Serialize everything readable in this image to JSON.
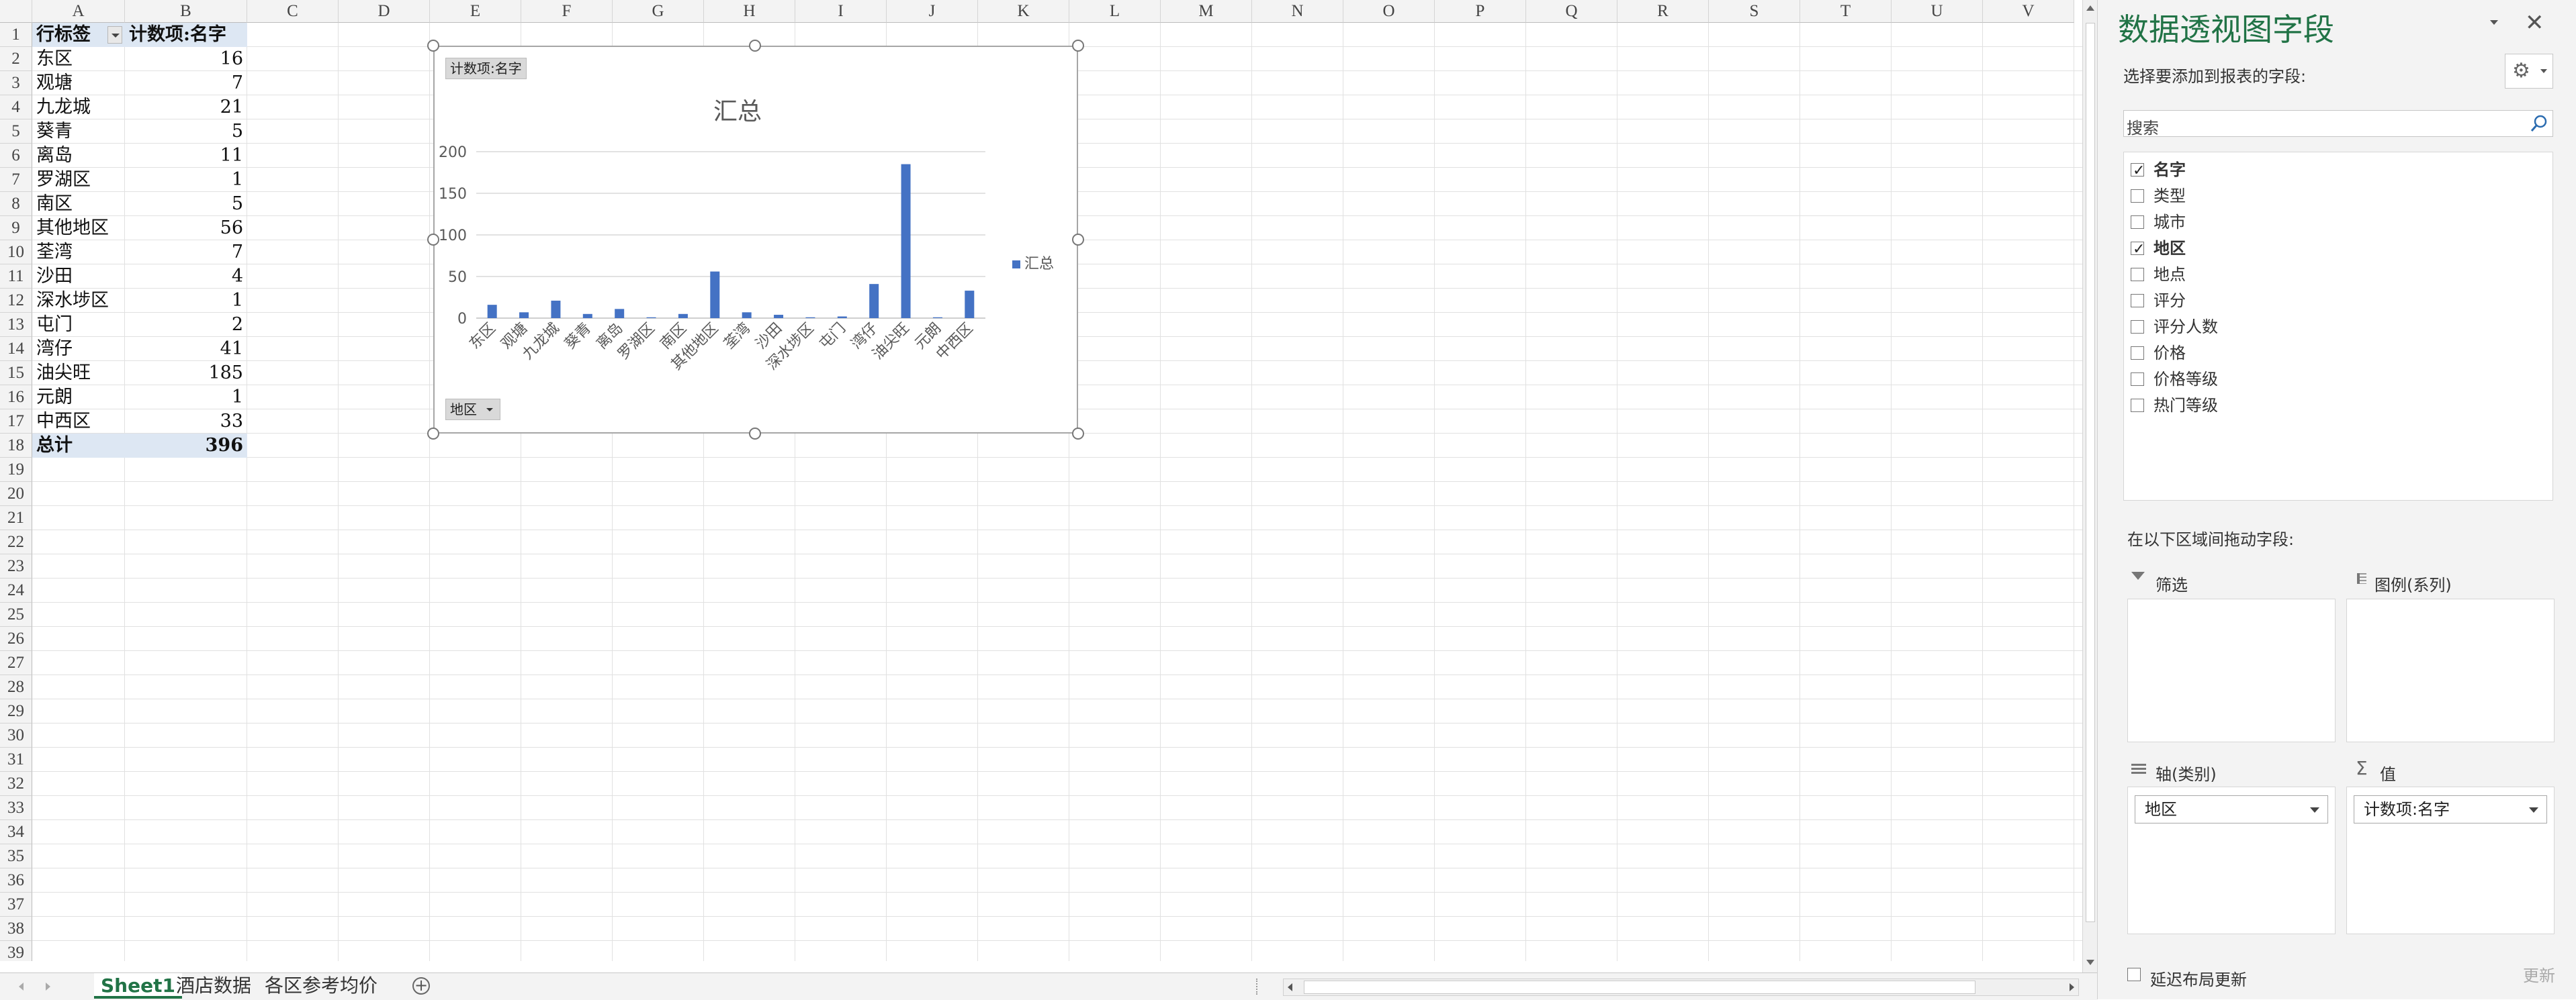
{
  "sheet": {
    "columns": [
      "A",
      "B",
      "C",
      "D",
      "E",
      "F",
      "G",
      "H",
      "I",
      "J",
      "K",
      "L",
      "M",
      "N",
      "O",
      "P",
      "Q",
      "R",
      "S",
      "T",
      "U",
      "V"
    ],
    "rows": [
      "1",
      "2",
      "3",
      "4",
      "5",
      "6",
      "7",
      "8",
      "9",
      "10",
      "11",
      "12",
      "13",
      "14",
      "15",
      "16",
      "17",
      "18",
      "19",
      "20",
      "21",
      "22",
      "23",
      "24",
      "25",
      "26",
      "27",
      "28",
      "29",
      "30",
      "31",
      "32",
      "33",
      "34",
      "35",
      "36",
      "37",
      "38",
      "39"
    ],
    "pivot_header": {
      "row_label": "行标签",
      "value_label": "计数项:名字"
    },
    "pivot_rows": [
      {
        "label": "东区",
        "value": "16"
      },
      {
        "label": "观塘",
        "value": "7"
      },
      {
        "label": "九龙城",
        "value": "21"
      },
      {
        "label": "葵青",
        "value": "5"
      },
      {
        "label": "离岛",
        "value": "11"
      },
      {
        "label": "罗湖区",
        "value": "1"
      },
      {
        "label": "南区",
        "value": "5"
      },
      {
        "label": "其他地区",
        "value": "56"
      },
      {
        "label": "荃湾",
        "value": "7"
      },
      {
        "label": "沙田",
        "value": "4"
      },
      {
        "label": "深水埗区",
        "value": "1"
      },
      {
        "label": "屯门",
        "value": "2"
      },
      {
        "label": "湾仔",
        "value": "41"
      },
      {
        "label": "油尖旺",
        "value": "185"
      },
      {
        "label": "元朗",
        "value": "1"
      },
      {
        "label": "中西区",
        "value": "33"
      }
    ],
    "pivot_total": {
      "label": "总计",
      "value": "396"
    }
  },
  "chart_field_buttons": {
    "value_field": "计数项:名字",
    "axis_field": "地区"
  },
  "chart_data": {
    "type": "bar",
    "title": "汇总",
    "categories": [
      "东区",
      "观塘",
      "九龙城",
      "葵青",
      "离岛",
      "罗湖区",
      "南区",
      "其他地区",
      "荃湾",
      "沙田",
      "深水埗区",
      "屯门",
      "湾仔",
      "油尖旺",
      "元朗",
      "中西区"
    ],
    "series": [
      {
        "name": "汇总",
        "values": [
          16,
          7,
          21,
          5,
          11,
          1,
          5,
          56,
          7,
          4,
          1,
          2,
          41,
          185,
          1,
          33
        ],
        "color": "#4472c4"
      }
    ],
    "yticks": [
      "0",
      "50",
      "100",
      "150",
      "200"
    ],
    "ylim": [
      0,
      200
    ],
    "grid": true,
    "legend": "right"
  },
  "tabs": [
    "Sheet1",
    "酒店数据",
    "各区参考均价"
  ],
  "active_tab": "Sheet1",
  "pane": {
    "title": "数据透视图字段",
    "choose_label": "选择要添加到报表的字段:",
    "search_placeholder": "搜索",
    "fields": [
      {
        "label": "名字",
        "checked": true
      },
      {
        "label": "类型",
        "checked": false
      },
      {
        "label": "城市",
        "checked": false
      },
      {
        "label": "地区",
        "checked": true
      },
      {
        "label": "地点",
        "checked": false
      },
      {
        "label": "评分",
        "checked": false
      },
      {
        "label": "评分人数",
        "checked": false
      },
      {
        "label": "价格",
        "checked": false
      },
      {
        "label": "价格等级",
        "checked": false
      },
      {
        "label": "热门等级",
        "checked": false
      }
    ],
    "drag_label": "在以下区域间拖动字段:",
    "zones": {
      "filter": "筛选",
      "legend": "图例(系列)",
      "axis": "轴(类别)",
      "values": "值"
    },
    "axis_item": "地区",
    "values_item": "计数项:名字",
    "defer_label": "延迟布局更新",
    "update_button": "更新"
  }
}
